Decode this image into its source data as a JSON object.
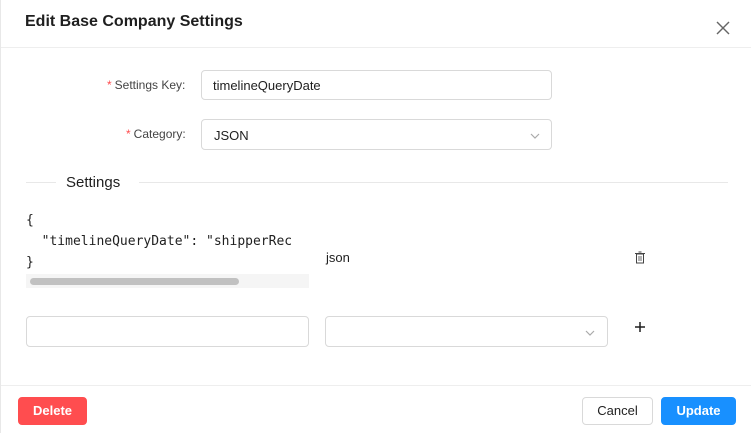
{
  "dialog": {
    "title": "Edit Base Company Settings"
  },
  "form": {
    "required_mark": "*",
    "settings_key_label": "Settings Key",
    "settings_key_value": "timelineQueryDate",
    "category_label": "Category",
    "category_value": "JSON",
    "label_colon": ":"
  },
  "settings": {
    "section_title": "Settings",
    "entries": [
      {
        "code_lines": [
          "{",
          "  \"timelineQueryDate\": \"shipperRec",
          "}"
        ],
        "type": "json"
      }
    ],
    "new_entry": {
      "key_value": "",
      "type_value": ""
    }
  },
  "footer": {
    "delete_label": "Delete",
    "cancel_label": "Cancel",
    "update_label": "Update"
  },
  "colors": {
    "danger": "#ff4d4f",
    "primary": "#1890ff",
    "border": "#d9d9d9"
  },
  "icons": {
    "close": "close-icon",
    "chevron": "chevron-down-icon",
    "delete": "trash-icon",
    "add": "plus-icon"
  }
}
